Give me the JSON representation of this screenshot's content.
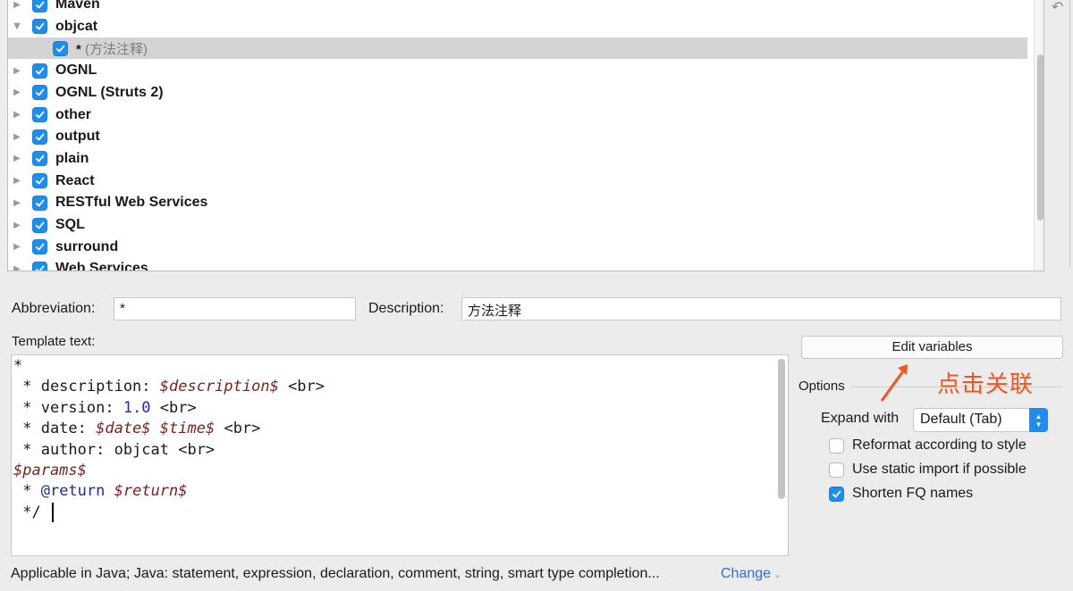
{
  "tree": {
    "rows": [
      {
        "label": "Maven",
        "expanded": false,
        "checked": true
      },
      {
        "label": "objcat",
        "expanded": true,
        "checked": true
      },
      {
        "label_key": "* ",
        "label_desc": "(方法注释)",
        "checked": true,
        "child": true,
        "selected": true
      },
      {
        "label": "OGNL",
        "expanded": false,
        "checked": true
      },
      {
        "label": "OGNL (Struts 2)",
        "expanded": false,
        "checked": true
      },
      {
        "label": "other",
        "expanded": false,
        "checked": true
      },
      {
        "label": "output",
        "expanded": false,
        "checked": true
      },
      {
        "label": "plain",
        "expanded": false,
        "checked": true
      },
      {
        "label": "React",
        "expanded": false,
        "checked": true
      },
      {
        "label": "RESTful Web Services",
        "expanded": false,
        "checked": true
      },
      {
        "label": "SQL",
        "expanded": false,
        "checked": true
      },
      {
        "label": "surround",
        "expanded": false,
        "checked": true
      },
      {
        "label": "Web Services",
        "expanded": false,
        "checked": true
      }
    ]
  },
  "abbreviation": {
    "label": "Abbreviation:",
    "value": "*"
  },
  "description": {
    "label": "Description:",
    "value": "方法注释"
  },
  "template": {
    "label": "Template text:",
    "lines": [
      [
        {
          "t": "*"
        }
      ],
      [
        {
          "t": " * description: "
        },
        {
          "t": "$description$",
          "c": "var"
        },
        {
          "t": " <br>"
        }
      ],
      [
        {
          "t": " * version: "
        },
        {
          "t": "1.0",
          "c": "num"
        },
        {
          "t": " <br>"
        }
      ],
      [
        {
          "t": " * date: "
        },
        {
          "t": "$date$",
          "c": "var"
        },
        {
          "t": " "
        },
        {
          "t": "$time$",
          "c": "var"
        },
        {
          "t": " <br>"
        }
      ],
      [
        {
          "t": " * author: objcat <br>"
        }
      ],
      [
        {
          "t": "$params$",
          "c": "var"
        }
      ],
      [
        {
          "t": " * "
        },
        {
          "t": "@return",
          "c": "kw"
        },
        {
          "t": " "
        },
        {
          "t": "$return$",
          "c": "var"
        }
      ],
      [
        {
          "t": " */ "
        },
        {
          "caret": true
        }
      ]
    ]
  },
  "edit_variables_label": "Edit variables",
  "options": {
    "title": "Options",
    "expand_with_label": "Expand with",
    "expand_with_value": "Default (Tab)",
    "checkboxes": [
      {
        "label": "Reformat according to style",
        "checked": false
      },
      {
        "label": "Use static import if possible",
        "checked": false
      },
      {
        "label": "Shorten FQ names",
        "checked": true
      }
    ]
  },
  "annotation": {
    "text": "点击关联",
    "color": "#f2551f"
  },
  "footer": {
    "applicable_text": "Applicable in Java; Java: statement, expression, declaration, comment, string, smart type completion...",
    "change_label": "Change"
  },
  "colors": {
    "accent": "#1f8df0",
    "selected_row": "#d4d4d4",
    "link": "#2f6fd6"
  },
  "icons": {
    "expand": "triangle-right-icon",
    "collapse": "triangle-down-icon",
    "undo": "undo-icon"
  }
}
